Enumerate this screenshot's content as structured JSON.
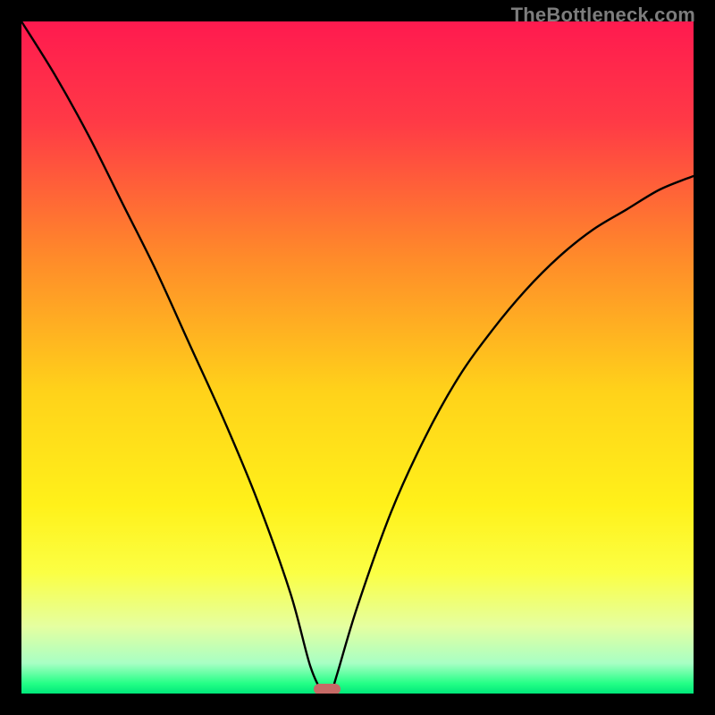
{
  "watermark": "TheBottleneck.com",
  "colors": {
    "marker": "#c66a66",
    "curve": "#000000",
    "frame": "#000000",
    "gradient_stops": [
      {
        "offset": 0.0,
        "color": "#ff1a4f"
      },
      {
        "offset": 0.15,
        "color": "#ff3a46"
      },
      {
        "offset": 0.35,
        "color": "#ff8a2a"
      },
      {
        "offset": 0.55,
        "color": "#ffd21a"
      },
      {
        "offset": 0.72,
        "color": "#fff11a"
      },
      {
        "offset": 0.82,
        "color": "#fbff44"
      },
      {
        "offset": 0.9,
        "color": "#e5ffa0"
      },
      {
        "offset": 0.955,
        "color": "#a8ffc4"
      },
      {
        "offset": 0.985,
        "color": "#24ff86"
      },
      {
        "offset": 1.0,
        "color": "#00e87a"
      }
    ]
  },
  "chart_data": {
    "type": "line",
    "title": "",
    "xlabel": "",
    "ylabel": "",
    "x": [
      0.0,
      0.05,
      0.1,
      0.15,
      0.2,
      0.25,
      0.3,
      0.35,
      0.4,
      0.43,
      0.45,
      0.46,
      0.47,
      0.5,
      0.55,
      0.6,
      0.65,
      0.7,
      0.75,
      0.8,
      0.85,
      0.9,
      0.95,
      1.0
    ],
    "values": [
      100,
      92,
      83,
      73,
      63,
      52,
      41,
      29,
      15,
      4,
      0,
      0,
      3,
      13,
      27,
      38,
      47,
      54,
      60,
      65,
      69,
      72,
      75,
      77
    ],
    "xlim": [
      0,
      1
    ],
    "ylim": [
      0,
      100
    ],
    "marker_x": 0.455,
    "marker_y": 0
  }
}
